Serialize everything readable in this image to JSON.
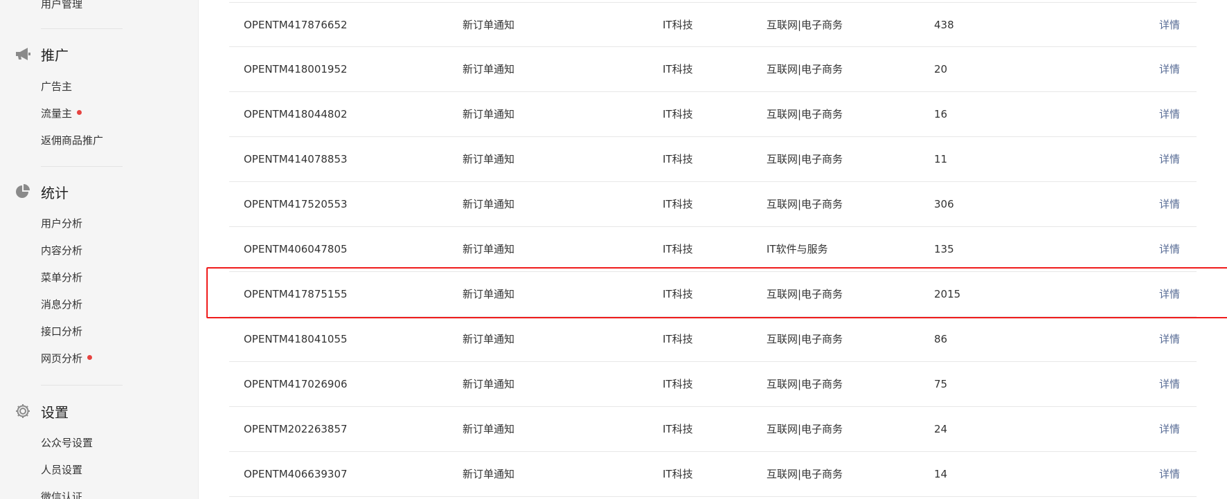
{
  "sidebar": {
    "top_item": {
      "label": "用户管理"
    },
    "sections": [
      {
        "title": "推广",
        "icon": "megaphone-icon",
        "items": [
          {
            "label": "广告主",
            "dot": false
          },
          {
            "label": "流量主",
            "dot": true
          },
          {
            "label": "返佣商品推广",
            "dot": false
          }
        ]
      },
      {
        "title": "统计",
        "icon": "pie-chart-icon",
        "items": [
          {
            "label": "用户分析",
            "dot": false
          },
          {
            "label": "内容分析",
            "dot": false
          },
          {
            "label": "菜单分析",
            "dot": false
          },
          {
            "label": "消息分析",
            "dot": false
          },
          {
            "label": "接口分析",
            "dot": false
          },
          {
            "label": "网页分析",
            "dot": true
          }
        ]
      },
      {
        "title": "设置",
        "icon": "gear-icon",
        "items": [
          {
            "label": "公众号设置",
            "dot": false
          },
          {
            "label": "人员设置",
            "dot": false
          },
          {
            "label": "微信认证",
            "dot": false
          }
        ]
      }
    ],
    "dot_color": "#e64340"
  },
  "table": {
    "rows": [
      {
        "id": "OPENTM417876652",
        "name": "新订单通知",
        "industry1": "IT科技",
        "industry2": "互联网|电子商务",
        "count": "438",
        "action": "详情"
      },
      {
        "id": "OPENTM418001952",
        "name": "新订单通知",
        "industry1": "IT科技",
        "industry2": "互联网|电子商务",
        "count": "20",
        "action": "详情"
      },
      {
        "id": "OPENTM418044802",
        "name": "新订单通知",
        "industry1": "IT科技",
        "industry2": "互联网|电子商务",
        "count": "16",
        "action": "详情"
      },
      {
        "id": "OPENTM414078853",
        "name": "新订单通知",
        "industry1": "IT科技",
        "industry2": "互联网|电子商务",
        "count": "11",
        "action": "详情"
      },
      {
        "id": "OPENTM417520553",
        "name": "新订单通知",
        "industry1": "IT科技",
        "industry2": "互联网|电子商务",
        "count": "306",
        "action": "详情"
      },
      {
        "id": "OPENTM406047805",
        "name": "新订单通知",
        "industry1": "IT科技",
        "industry2": "IT软件与服务",
        "count": "135",
        "action": "详情"
      },
      {
        "id": "OPENTM417875155",
        "name": "新订单通知",
        "industry1": "IT科技",
        "industry2": "互联网|电子商务",
        "count": "2015",
        "action": "详情"
      },
      {
        "id": "OPENTM418041055",
        "name": "新订单通知",
        "industry1": "IT科技",
        "industry2": "互联网|电子商务",
        "count": "86",
        "action": "详情"
      },
      {
        "id": "OPENTM417026906",
        "name": "新订单通知",
        "industry1": "IT科技",
        "industry2": "互联网|电子商务",
        "count": "75",
        "action": "详情"
      },
      {
        "id": "OPENTM202263857",
        "name": "新订单通知",
        "industry1": "IT科技",
        "industry2": "互联网|电子商务",
        "count": "24",
        "action": "详情"
      },
      {
        "id": "OPENTM406639307",
        "name": "新订单通知",
        "industry1": "IT科技",
        "industry2": "互联网|电子商务",
        "count": "14",
        "action": "详情"
      }
    ],
    "highlighted_row_index": 6,
    "highlight_color": "#ef1b1b",
    "link_color": "#576b95"
  }
}
